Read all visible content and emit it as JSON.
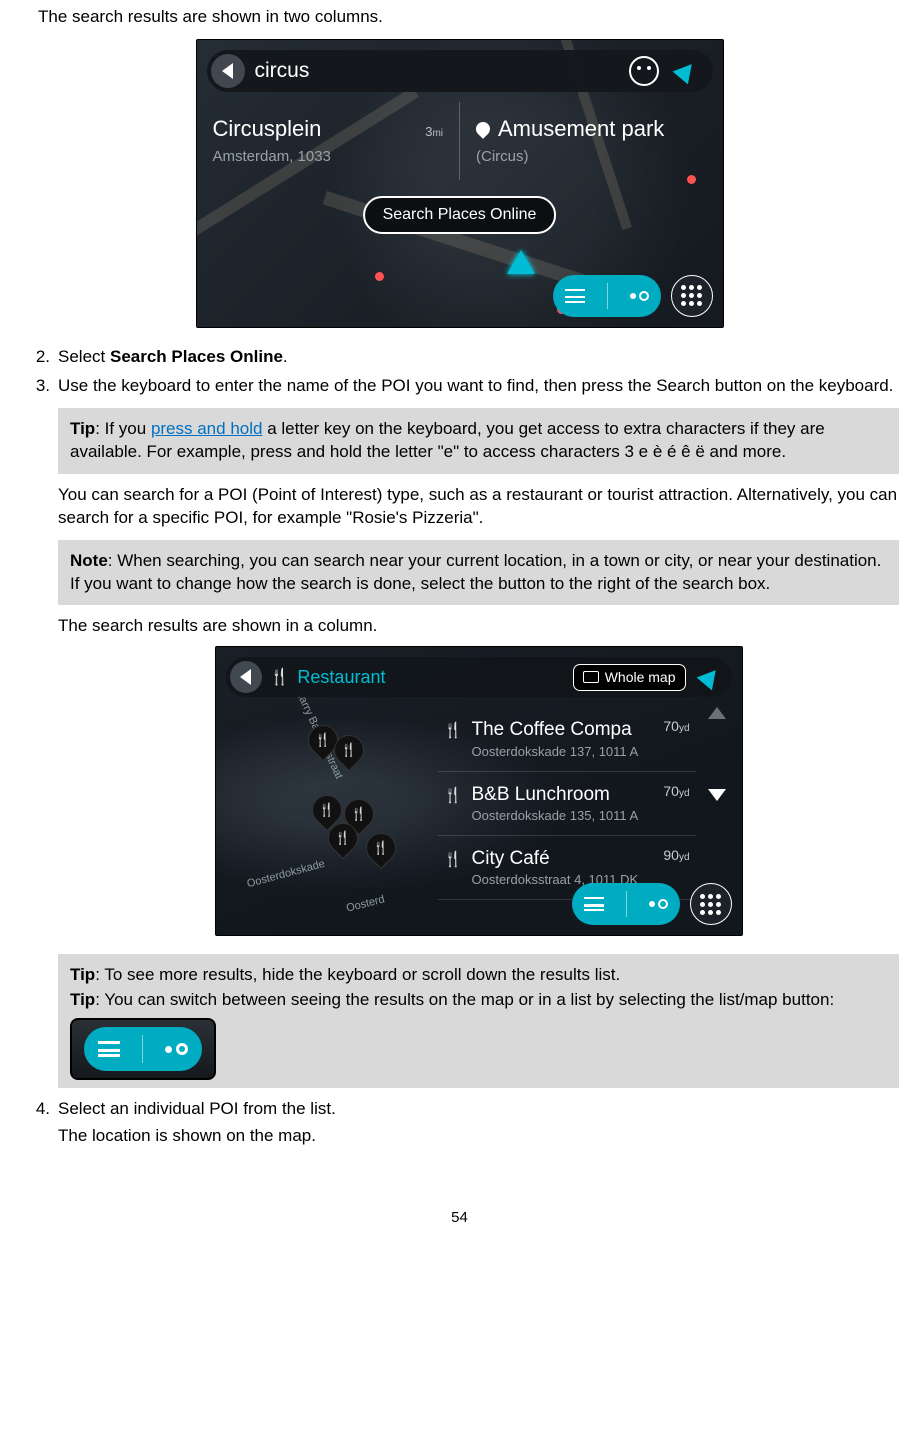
{
  "intro": "The search results are shown in two columns.",
  "screenshot1": {
    "search_query": "circus",
    "left": {
      "title": "Circusplein",
      "subtitle": "Amsterdam, 1033",
      "distance": "3",
      "distance_unit": "mi"
    },
    "right": {
      "title": "Amusement park",
      "subtitle": "(Circus)"
    },
    "online_button": "Search Places Online"
  },
  "steps": {
    "s2_num": "2.",
    "s2_a": "Select ",
    "s2_b": "Search Places Online",
    "s2_c": ".",
    "s3_num": "3.",
    "s3": "Use the keyboard to enter the name of the POI you want to find, then press the Search button on the keyboard.",
    "s4_num": "4.",
    "s4_a": "Select an individual POI from the list.",
    "s4_b": "The location is shown on the map."
  },
  "tip1": {
    "label": "Tip",
    "a": ": If you ",
    "link": "press and hold",
    "b": " a letter key on the keyboard, you get access to extra characters if they are available. For example, press and hold the letter \"e\" to access characters 3 e è é ê ë and more."
  },
  "para1": "You can search for a POI (Point of Interest) type, such as a restaurant or tourist attraction. Alternatively, you can search for a specific POI, for example \"Rosie's Pizzeria\".",
  "note1": {
    "label": "Note",
    "text": ": When searching, you can search near your current location, in a town or city, or near your destination. If you want to change how the search is done, select the button to the right of the search box."
  },
  "para2": "The search results are shown in a column.",
  "screenshot2": {
    "category": "Restaurant",
    "scope": "Whole map",
    "results": [
      {
        "title": "The Coffee Compa",
        "addr": "Oosterdokskade 137, 1011 A",
        "dist": "70",
        "unit": "yd"
      },
      {
        "title": "B&B Lunchroom",
        "addr": "Oosterdokskade 135, 1011 A",
        "dist": "70",
        "unit": "yd"
      },
      {
        "title": "City Café",
        "addr": "Oosterdoksstraat 4, 1011 DK",
        "dist": "90",
        "unit": "yd"
      }
    ],
    "streets": [
      "Harry Banninkstraat",
      "Oosterdokskade",
      "Oosterd"
    ]
  },
  "tip2": {
    "label": "Tip",
    "text": ": To see more results, hide the keyboard or scroll down the results list."
  },
  "tip3": {
    "label": "Tip",
    "text": ": You can switch between seeing the results on the map or in a list by selecting the list/map button:"
  },
  "page_number": "54"
}
